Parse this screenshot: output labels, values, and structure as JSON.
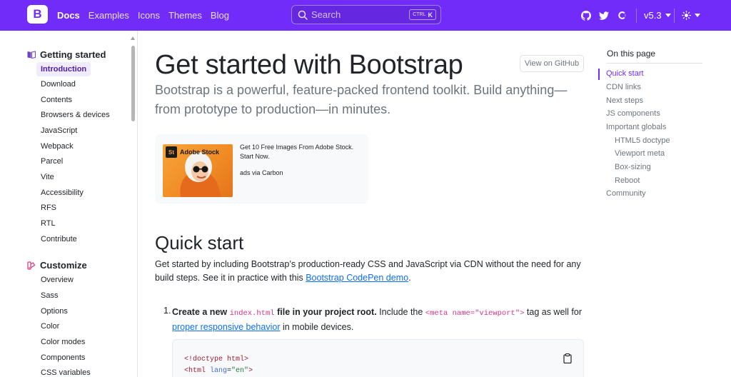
{
  "navbar": {
    "brand_letter": "B",
    "links": [
      {
        "label": "Docs",
        "active": true
      },
      {
        "label": "Examples",
        "active": false
      },
      {
        "label": "Icons",
        "active": false
      },
      {
        "label": "Themes",
        "active": false
      },
      {
        "label": "Blog",
        "active": false
      }
    ],
    "search": {
      "placeholder": "Search",
      "shortcut_ctrl": "CTRL",
      "shortcut_key": "K"
    },
    "icons": [
      "github-icon",
      "twitter-icon",
      "opencollective-icon"
    ],
    "version": "v5.3",
    "theme_icon": "sun-icon",
    "accent_color": "#712cf9"
  },
  "sidebar": {
    "groups": [
      {
        "title": "Getting started",
        "icon": "book-icon",
        "items": [
          {
            "label": "Introduction",
            "active": true
          },
          {
            "label": "Download"
          },
          {
            "label": "Contents"
          },
          {
            "label": "Browsers & devices"
          },
          {
            "label": "JavaScript"
          },
          {
            "label": "Webpack"
          },
          {
            "label": "Parcel"
          },
          {
            "label": "Vite"
          },
          {
            "label": "Accessibility"
          },
          {
            "label": "RFS"
          },
          {
            "label": "RTL"
          },
          {
            "label": "Contribute"
          }
        ]
      },
      {
        "title": "Customize",
        "icon": "palette-icon",
        "items": [
          {
            "label": "Overview"
          },
          {
            "label": "Sass"
          },
          {
            "label": "Options"
          },
          {
            "label": "Color"
          },
          {
            "label": "Color modes"
          },
          {
            "label": "Components"
          },
          {
            "label": "CSS variables"
          }
        ]
      }
    ]
  },
  "main": {
    "title": "Get started with Bootstrap",
    "github_button": "View on GitHub",
    "lead": "Bootstrap is a powerful, feature-packed frontend toolkit. Build anything—from prototype to production—in minutes.",
    "ad": {
      "brand": "Adobe Stock",
      "brand_mark": "St",
      "text": "Get 10 Free Images From Adobe Stock. Start Now.",
      "via": "ads via Carbon"
    },
    "section_title": "Quick start",
    "para_text": "Get started by including Bootstrap’s production-ready CSS and JavaScript via CDN without the need for any build steps. See it in practice with this ",
    "para_link": "Bootstrap CodePen demo",
    "para_end": ".",
    "step1": {
      "num": "1.",
      "bold_a": "Create a new ",
      "code_file": "index.html",
      "bold_b": " file in your project root.",
      "text_a": " Include the ",
      "code_meta": "<meta name=\"viewport\">",
      "text_b": " tag as well for ",
      "link": "proper responsive behavior",
      "text_c": " in mobile devices."
    },
    "code_lines": {
      "line1": "<!doctype html>",
      "line2_tag": "<html ",
      "line2_attr": "lang",
      "line2_eq": "=",
      "line2_str": "\"en\"",
      "line2_end": ">"
    }
  },
  "toc": {
    "title": "On this page",
    "items": [
      {
        "label": "Quick start",
        "active": true
      },
      {
        "label": "CDN links"
      },
      {
        "label": "Next steps"
      },
      {
        "label": "JS components"
      },
      {
        "label": "Important globals"
      },
      {
        "label": "HTML5 doctype",
        "sub": true
      },
      {
        "label": "Viewport meta",
        "sub": true
      },
      {
        "label": "Box-sizing",
        "sub": true
      },
      {
        "label": "Reboot",
        "sub": true
      },
      {
        "label": "Community"
      }
    ]
  }
}
